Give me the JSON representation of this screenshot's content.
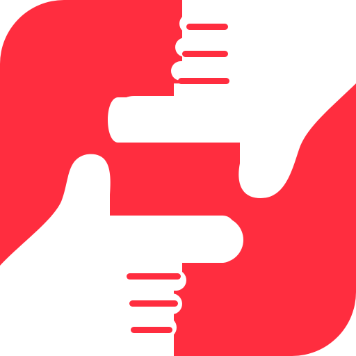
{
  "app_icon": {
    "name": "framing-hands-icon",
    "colors": {
      "background": "#ff2d3f",
      "hands": "#ffffff",
      "outer": "#ffffff"
    }
  }
}
